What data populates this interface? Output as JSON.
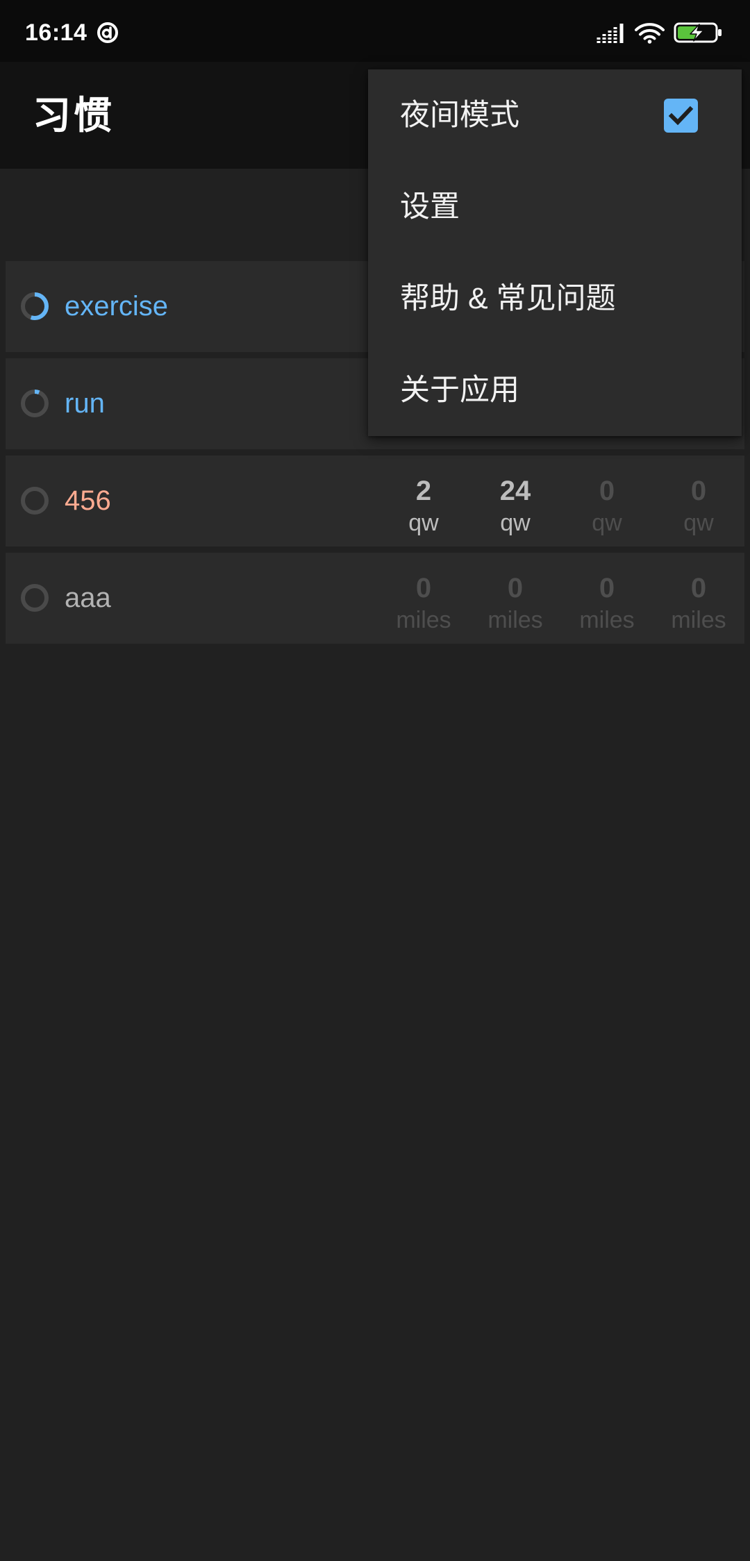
{
  "status_bar": {
    "time": "16:14",
    "icons": {
      "notification": "app-notification-icon",
      "signal": "signal-icon",
      "wifi": "wifi-icon",
      "battery": "battery-charging-icon"
    },
    "battery_level": 0.55,
    "battery_color": "#5ac43c"
  },
  "app_bar": {
    "title": "习惯"
  },
  "habits": [
    {
      "name": "exercise",
      "color": "#64b5f6",
      "score": 0.55
    },
    {
      "name": "run",
      "color": "#64b5f6",
      "score": 0.06
    },
    {
      "name": "456",
      "color": "#ffab91",
      "score": 0,
      "unit": "qw",
      "values": [
        "2",
        "24",
        "0",
        "0"
      ]
    },
    {
      "name": "aaa",
      "color": "#b3b3b3",
      "score": 0,
      "unit": "miles",
      "values": [
        "0",
        "0",
        "0",
        "0"
      ]
    }
  ],
  "menu": {
    "items": [
      {
        "label": "夜间模式",
        "checked": true
      },
      {
        "label": "设置"
      },
      {
        "label": "帮助 & 常见问题"
      },
      {
        "label": "关于应用"
      }
    ],
    "checkbox_color": "#64b5f6"
  }
}
